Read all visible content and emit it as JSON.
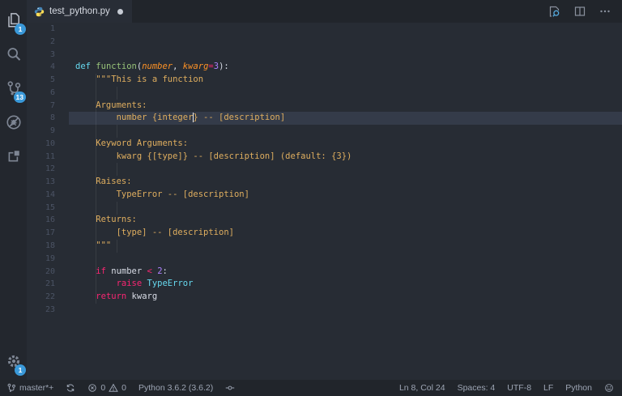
{
  "colors": {
    "editor_bg": "#272c34",
    "panel_bg": "#21252b",
    "activity_bg": "#23272e",
    "badge_blue": "#3a99d9",
    "active_line": "#343b49",
    "syntax_keyword": "#f92672",
    "syntax_type": "#66d9ef",
    "syntax_function": "#98c379",
    "syntax_param": "#fd9226",
    "syntax_number": "#ae81ff",
    "syntax_string": "#dfae5f"
  },
  "activity_bar": {
    "items": [
      {
        "id": "explorer",
        "icon": "files-icon",
        "badge": "1",
        "bright": true
      },
      {
        "id": "search",
        "icon": "search-icon"
      },
      {
        "id": "source-control",
        "icon": "branch-icon",
        "badge": "13"
      },
      {
        "id": "debug",
        "icon": "debug-icon"
      },
      {
        "id": "extensions",
        "icon": "extensions-icon"
      }
    ],
    "settings": {
      "id": "settings",
      "icon": "gear-icon",
      "badge": "1"
    }
  },
  "tabs": {
    "active": {
      "label": "test_python.py",
      "modified": true
    }
  },
  "editor_actions": [
    {
      "id": "open-changes",
      "icon": "diff-icon"
    },
    {
      "id": "split-editor",
      "icon": "split-icon"
    },
    {
      "id": "more-actions",
      "icon": "ellipsis-icon"
    }
  ],
  "editor": {
    "active_line": 8,
    "cursor": {
      "line": 8,
      "col": 24
    },
    "lines": [
      {
        "n": 1,
        "tokens": []
      },
      {
        "n": 2,
        "tokens": []
      },
      {
        "n": 3,
        "tokens": []
      },
      {
        "n": 4,
        "tokens": [
          {
            "t": "def",
            "c": "cy"
          },
          {
            "t": " ",
            "c": "pl"
          },
          {
            "t": "function",
            "c": "gr"
          },
          {
            "t": "(",
            "c": "pl"
          },
          {
            "t": "number",
            "c": "or"
          },
          {
            "t": ", ",
            "c": "pl"
          },
          {
            "t": "kwarg",
            "c": "or"
          },
          {
            "t": "=",
            "c": "kw"
          },
          {
            "t": "3",
            "c": "pu"
          },
          {
            "t": "):",
            "c": "pl"
          }
        ]
      },
      {
        "n": 5,
        "tokens": [
          {
            "t": "    \"\"\"This is a function",
            "c": "st"
          }
        ]
      },
      {
        "n": 6,
        "tokens": []
      },
      {
        "n": 7,
        "tokens": [
          {
            "t": "    Arguments:",
            "c": "st"
          }
        ]
      },
      {
        "n": 8,
        "tokens": [
          {
            "t": "        number {integer",
            "c": "st"
          },
          {
            "cursor": true
          },
          {
            "t": "} -- [description]",
            "c": "st"
          }
        ]
      },
      {
        "n": 9,
        "tokens": []
      },
      {
        "n": 10,
        "tokens": [
          {
            "t": "    Keyword Arguments:",
            "c": "st"
          }
        ]
      },
      {
        "n": 11,
        "tokens": [
          {
            "t": "        kwarg {[type]} -- [description] (default: {3})",
            "c": "st"
          }
        ]
      },
      {
        "n": 12,
        "tokens": []
      },
      {
        "n": 13,
        "tokens": [
          {
            "t": "    Raises:",
            "c": "st"
          }
        ]
      },
      {
        "n": 14,
        "tokens": [
          {
            "t": "        TypeError -- [description]",
            "c": "st"
          }
        ]
      },
      {
        "n": 15,
        "tokens": []
      },
      {
        "n": 16,
        "tokens": [
          {
            "t": "    Returns:",
            "c": "st"
          }
        ]
      },
      {
        "n": 17,
        "tokens": [
          {
            "t": "        [type] -- [description]",
            "c": "st"
          }
        ]
      },
      {
        "n": 18,
        "tokens": [
          {
            "t": "    \"\"\"",
            "c": "st"
          }
        ]
      },
      {
        "n": 19,
        "tokens": []
      },
      {
        "n": 20,
        "tokens": [
          {
            "t": "    ",
            "c": "pl"
          },
          {
            "t": "if",
            "c": "kw"
          },
          {
            "t": " number ",
            "c": "pl"
          },
          {
            "t": "<",
            "c": "kw"
          },
          {
            "t": " ",
            "c": "pl"
          },
          {
            "t": "2",
            "c": "pu"
          },
          {
            "t": ":",
            "c": "pl"
          }
        ]
      },
      {
        "n": 21,
        "tokens": [
          {
            "t": "        ",
            "c": "pl"
          },
          {
            "t": "raise",
            "c": "kw"
          },
          {
            "t": " ",
            "c": "pl"
          },
          {
            "t": "TypeError",
            "c": "cy"
          }
        ]
      },
      {
        "n": 22,
        "tokens": [
          {
            "t": "    ",
            "c": "pl"
          },
          {
            "t": "return",
            "c": "kw"
          },
          {
            "t": " kwarg",
            "c": "pl"
          }
        ]
      },
      {
        "n": 23,
        "tokens": []
      }
    ]
  },
  "status_bar": {
    "left": [
      {
        "id": "git-branch",
        "parts": [
          {
            "icon": "branch-icon"
          },
          {
            "text": "master*+"
          }
        ]
      },
      {
        "id": "sync",
        "parts": [
          {
            "icon": "sync-icon"
          }
        ]
      },
      {
        "id": "problems",
        "parts": [
          {
            "icon": "error-icon"
          },
          {
            "text": "0"
          },
          {
            "icon": "warning-icon"
          },
          {
            "text": "0"
          }
        ]
      },
      {
        "id": "python-interpreter",
        "parts": [
          {
            "text": "Python 3.6.2 (3.6.2)"
          }
        ]
      },
      {
        "id": "connector",
        "parts": [
          {
            "icon": "connector-icon"
          }
        ]
      }
    ],
    "right": [
      {
        "id": "cursor-position",
        "parts": [
          {
            "text": "Ln 8, Col 24"
          }
        ]
      },
      {
        "id": "indentation",
        "parts": [
          {
            "text": "Spaces: 4"
          }
        ]
      },
      {
        "id": "encoding",
        "parts": [
          {
            "text": "UTF-8"
          }
        ]
      },
      {
        "id": "eol",
        "parts": [
          {
            "text": "LF"
          }
        ]
      },
      {
        "id": "language-mode",
        "parts": [
          {
            "text": "Python"
          }
        ]
      },
      {
        "id": "feedback",
        "parts": [
          {
            "icon": "smiley-icon"
          }
        ]
      }
    ]
  }
}
